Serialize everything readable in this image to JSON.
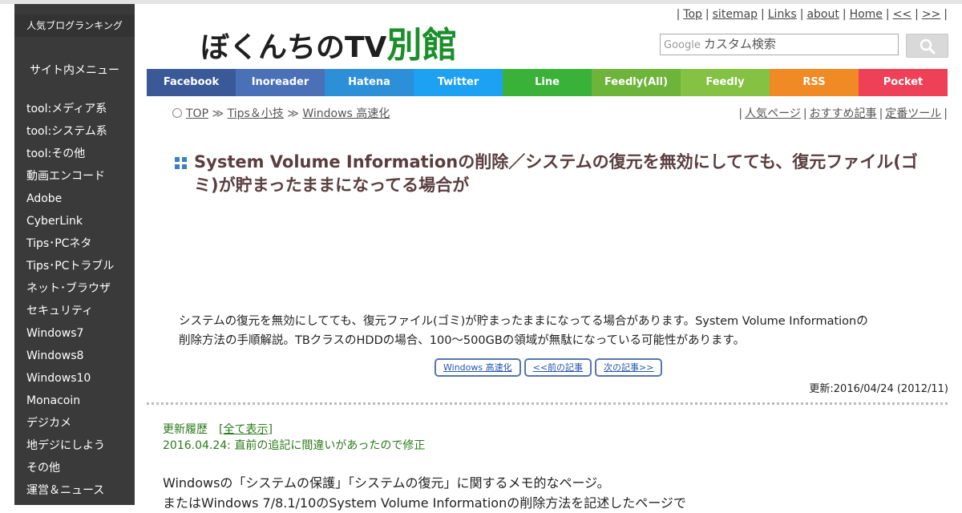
{
  "sidebar": {
    "ranking_label": "人気ブログランキング",
    "menu_title": "サイト内メニュー",
    "items": [
      "tool:メディア系",
      "tool:システム系",
      "tool:その他",
      "動画エンコード",
      "Adobe",
      "CyberLink",
      "Tips･PCネタ",
      "Tips･PCトラブル",
      "ネット･ブラウザ",
      "セキュリティ",
      "Windows7",
      "Windows8",
      "Windows10",
      "Monacoin",
      "デジカメ",
      "地デジにしよう",
      "その他",
      "運営＆ニュース"
    ]
  },
  "header": {
    "logo_main": "ぼくんちのTV",
    "logo_accent": "別館",
    "top_links": [
      "Top",
      "sitemap",
      "Links",
      "about",
      "Home",
      "<<",
      ">>"
    ],
    "search_brand": "Google",
    "search_placeholder": "カスタム検索"
  },
  "social": [
    {
      "label": "Facebook",
      "color": "#3b5998"
    },
    {
      "label": "Inoreader",
      "color": "#4a70b8"
    },
    {
      "label": "Hatena",
      "color": "#2d8fd8"
    },
    {
      "label": "Twitter",
      "color": "#1da1f2"
    },
    {
      "label": "Line",
      "color": "#3ab23a"
    },
    {
      "label": "Feedly(All)",
      "color": "#6db43a"
    },
    {
      "label": "Feedly",
      "color": "#85c142"
    },
    {
      "label": "RSS",
      "color": "#f08a24"
    },
    {
      "label": "Pocket",
      "color": "#ee4056"
    }
  ],
  "breadcrumb": {
    "items": [
      "TOP",
      "Tips＆小技",
      "Windows 高速化"
    ],
    "sep": "≫"
  },
  "right_links": [
    "人気ページ",
    "おすすめ記事",
    "定番ツール"
  ],
  "article": {
    "title": "System Volume Informationの削除／システムの復元を無効にしてても、復元ファイル(ゴミ)が貯まったままになってる場合が",
    "intro_line1": "システムの復元を無効にしてても、復元ファイル(ゴミ)が貯まったままになってる場合があります。System Volume Informationの",
    "intro_line2": "削除方法の手順解説。TBクラスのHDDの場合、100～500GBの領域が無駄になっている可能性があります。",
    "nav_buttons": [
      "Windows 高速化",
      "<<前の記事",
      "次の記事>>"
    ],
    "updated": "更新:2016/04/24 (2012/11)",
    "history_label": "更新履歴　[",
    "history_link": "全て表示",
    "history_close": "]",
    "history_entry": "2016.04.24: 直前の追記に間違いがあったので修正",
    "body_line1": "Windowsの「システムの保護」「システムの復元」に関するメモ的なページ。",
    "body_line2": "またはWindows 7/8.1/10のSystem Volume Informationの削除方法を記述したページで"
  }
}
